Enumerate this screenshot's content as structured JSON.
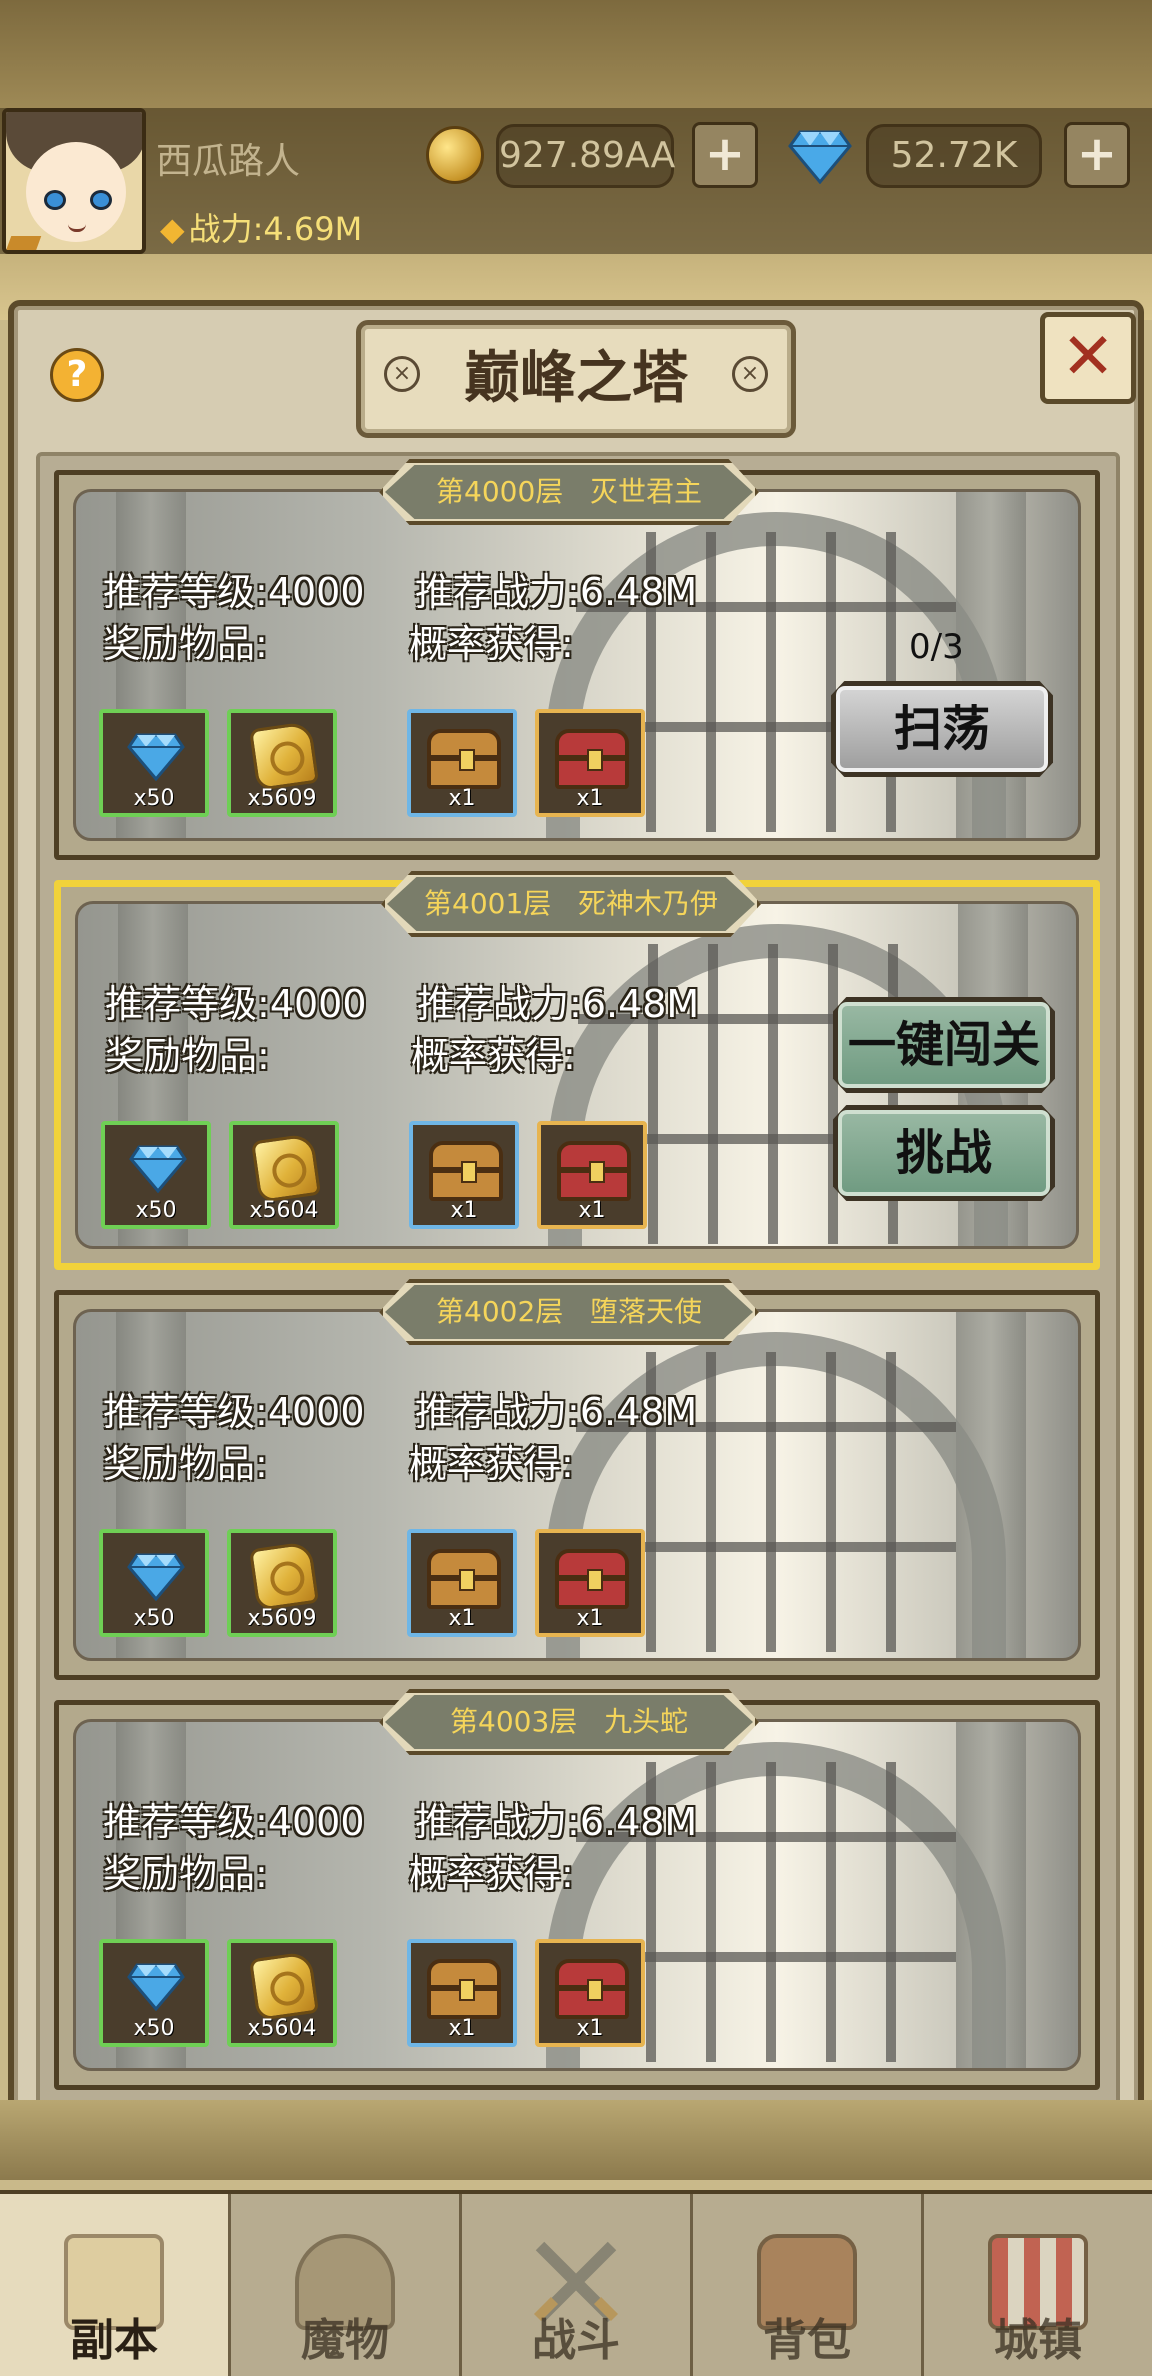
{
  "player": {
    "name": "西瓜路人",
    "power_label": "战力:4.69M",
    "gold": "927.89AA",
    "gems": "52.72K"
  },
  "header": {
    "title": "巅峰之塔",
    "help": "?",
    "close": "✕",
    "plus": "+"
  },
  "labels": {
    "level_prefix": "推荐等级:",
    "power_prefix": "推荐战力:",
    "reward_label": "奖励物品:",
    "chance_label": "概率获得:"
  },
  "floors": [
    {
      "title": "第4000层   灭世君主",
      "level": "4000",
      "power": "6.48M",
      "rewards": [
        {
          "icon": "diamond-icon",
          "qty": "x50",
          "frame": "green"
        },
        {
          "icon": "gold-ore-icon",
          "qty": "x5609",
          "frame": "green"
        }
      ],
      "chance": [
        {
          "icon": "wooden-chest-icon",
          "qty": "x1",
          "frame": "blue"
        },
        {
          "icon": "red-chest-icon",
          "qty": "x1",
          "frame": "orange"
        }
      ],
      "progress": "0/3",
      "actions": [
        "扫荡"
      ]
    },
    {
      "title": "第4001层   死神木乃伊",
      "level": "4000",
      "power": "6.48M",
      "rewards": [
        {
          "icon": "diamond-icon",
          "qty": "x50",
          "frame": "green"
        },
        {
          "icon": "gold-ore-icon",
          "qty": "x5604",
          "frame": "green"
        }
      ],
      "chance": [
        {
          "icon": "wooden-chest-icon",
          "qty": "x1",
          "frame": "blue"
        },
        {
          "icon": "red-chest-icon",
          "qty": "x1",
          "frame": "orange"
        }
      ],
      "actions": [
        "一键闯关",
        "挑战"
      ],
      "selected": true
    },
    {
      "title": "第4002层   堕落天使",
      "level": "4000",
      "power": "6.48M",
      "rewards": [
        {
          "icon": "diamond-icon",
          "qty": "x50",
          "frame": "green"
        },
        {
          "icon": "gold-ore-icon",
          "qty": "x5609",
          "frame": "green"
        }
      ],
      "chance": [
        {
          "icon": "wooden-chest-icon",
          "qty": "x1",
          "frame": "blue"
        },
        {
          "icon": "red-chest-icon",
          "qty": "x1",
          "frame": "orange"
        }
      ]
    },
    {
      "title": "第4003层   九头蛇",
      "level": "4000",
      "power": "6.48M",
      "rewards": [
        {
          "icon": "diamond-icon",
          "qty": "x50",
          "frame": "green"
        },
        {
          "icon": "gold-ore-icon",
          "qty": "x5604",
          "frame": "green"
        }
      ],
      "chance": [
        {
          "icon": "wooden-chest-icon",
          "qty": "x1",
          "frame": "blue"
        },
        {
          "icon": "red-chest-icon",
          "qty": "x1",
          "frame": "orange"
        }
      ]
    }
  ],
  "nav": [
    {
      "label": "副本",
      "icon": "map-scroll-icon",
      "active": true
    },
    {
      "label": "魔物",
      "icon": "monster-helmet-icon"
    },
    {
      "label": "战斗",
      "icon": "crossed-swords-icon"
    },
    {
      "label": "背包",
      "icon": "backpack-icon"
    },
    {
      "label": "城镇",
      "icon": "town-building-icon"
    }
  ],
  "colors": {
    "selected_border": "#f1d23a",
    "reward_frame_green": "#6fcf55",
    "chance_frame_blue": "#6fb6e6",
    "chance_frame_orange": "#e7b450",
    "floor_title_text": "#f5d55a",
    "close_icon": "#a23020"
  }
}
